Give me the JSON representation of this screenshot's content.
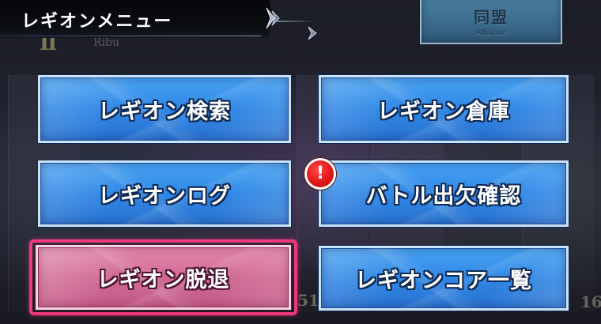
{
  "header": {
    "title": "レギオンメニュー"
  },
  "alliance_button": {
    "label": "同盟",
    "sublabel": "Alliance"
  },
  "background": {
    "rank_mark": "II",
    "rank_text": "Ribu",
    "numbers": [
      "51",
      "16"
    ]
  },
  "menu": {
    "legion_search": "レギオン検索",
    "legion_warehouse": "レギオン倉庫",
    "legion_log": "レギオンログ",
    "battle_attendance": "バトル出欠確認",
    "legion_leave": "レギオン脱退",
    "legion_core_list": "レギオンコア一覧"
  },
  "notification": {
    "mark": "!"
  },
  "colors": {
    "button_blue": "#2f86e4",
    "button_pink": "#d06a94",
    "highlight": "#ee3a7d",
    "badge_red": "#e01818"
  }
}
